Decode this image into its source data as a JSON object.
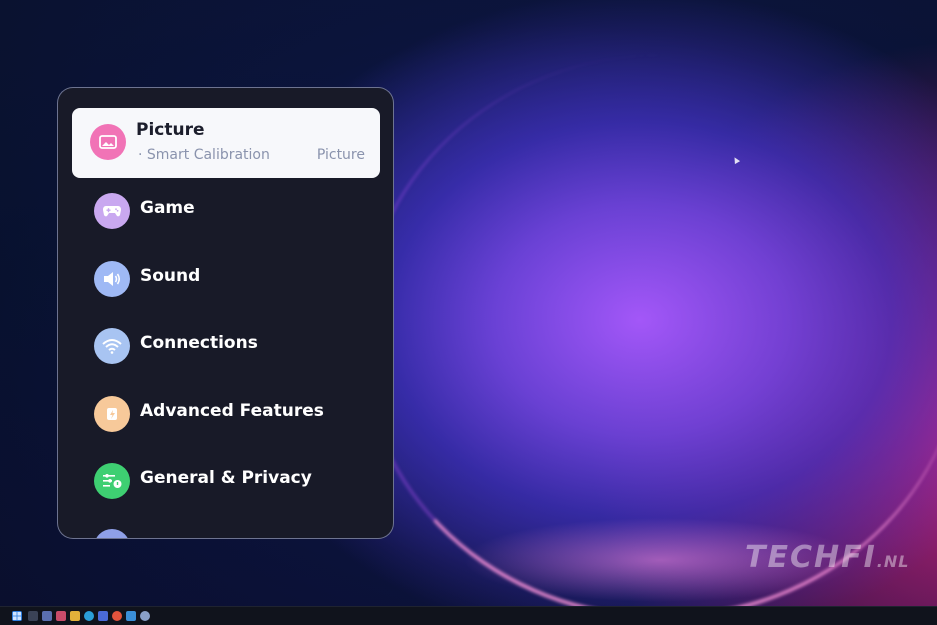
{
  "settings_menu": {
    "items": [
      {
        "label": "Picture",
        "icon": "picture-icon",
        "icon_color": "#f173b6",
        "selected": true,
        "sub_left": "· Smart Calibration",
        "sub_right": "Picture"
      },
      {
        "label": "Game",
        "icon": "gamepad-icon",
        "icon_color": "#c9a8f0",
        "selected": false
      },
      {
        "label": "Sound",
        "icon": "speaker-icon",
        "icon_color": "#9fb9f5",
        "selected": false
      },
      {
        "label": "Connections",
        "icon": "wifi-icon",
        "icon_color": "#a8c4f2",
        "selected": false
      },
      {
        "label": "Advanced Features",
        "icon": "advanced-features-icon",
        "icon_color": "#f7c99a",
        "selected": false
      },
      {
        "label": "General & Privacy",
        "icon": "general-privacy-icon",
        "icon_color": "#3ecf72",
        "selected": false
      }
    ]
  },
  "watermark": {
    "main": "TECHFI",
    "suffix": ".NL"
  },
  "taskbar": {
    "icons": [
      "start-icon",
      "search-icon",
      "task-view-icon",
      "widgets-icon",
      "file-explorer-icon",
      "edge-icon",
      "store-icon",
      "chrome-icon",
      "app-icon",
      "settings-icon"
    ]
  },
  "colors": {
    "panel_bg": "#181a28",
    "selected_bg": "#f7f8fb",
    "accent_pink": "#f173b6"
  }
}
